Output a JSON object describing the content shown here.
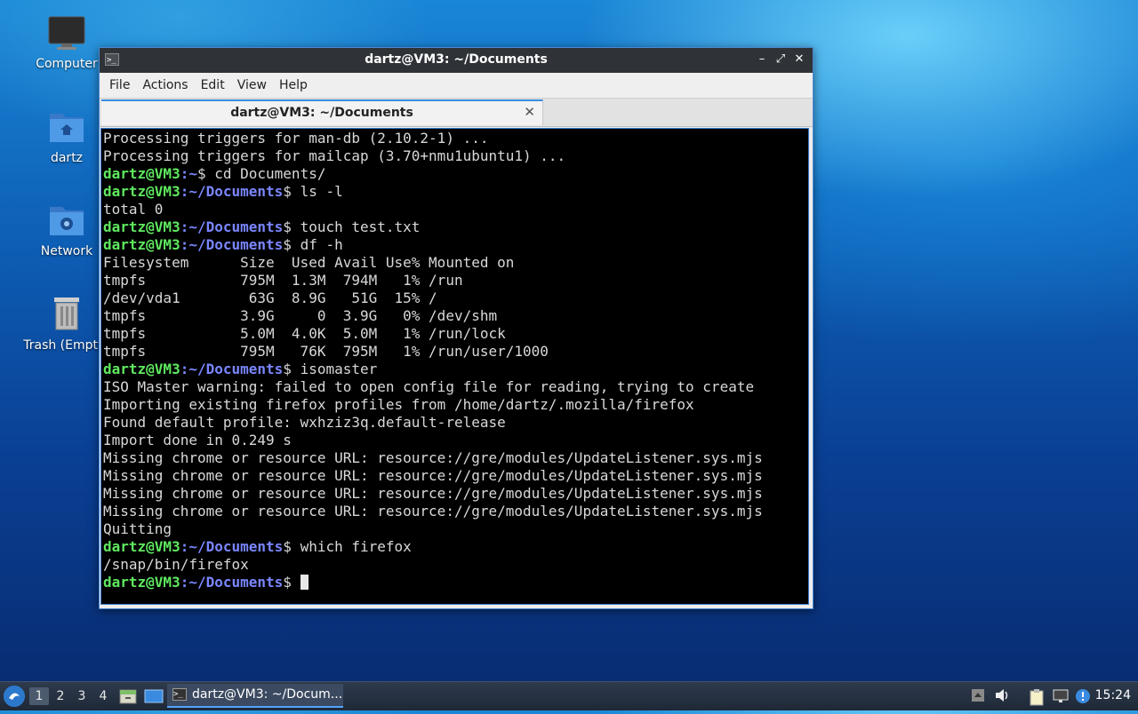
{
  "desktop": {
    "icons": [
      {
        "label": "Computer",
        "icon": "monitor-icon"
      },
      {
        "label": "dartz",
        "icon": "home-folder-icon"
      },
      {
        "label": "Network",
        "icon": "network-folder-icon"
      },
      {
        "label": "Trash (Empty)",
        "icon": "trash-icon"
      }
    ]
  },
  "window": {
    "title": "dartz@VM3: ~/Documents",
    "controls": {
      "minimize": "–",
      "maximize": "⤢",
      "close": "✕"
    },
    "menu": [
      "File",
      "Actions",
      "Edit",
      "View",
      "Help"
    ],
    "tab": {
      "label": "dartz@VM3: ~/Documents",
      "close": "✕"
    }
  },
  "terminal": {
    "prompt_user": "dartz@VM3",
    "lines": [
      {
        "text": "Processing triggers for man-db (2.10.2-1) ..."
      },
      {
        "text": "Processing triggers for mailcap (3.70+nmu1ubuntu1) ..."
      },
      {
        "prompt": true,
        "path": "~",
        "cmd": "cd Documents/"
      },
      {
        "prompt": true,
        "path": "~/Documents",
        "cmd": "ls -l"
      },
      {
        "text": "total 0"
      },
      {
        "prompt": true,
        "path": "~/Documents",
        "cmd": "touch test.txt"
      },
      {
        "prompt": true,
        "path": "~/Documents",
        "cmd": "df -h"
      },
      {
        "text": "Filesystem      Size  Used Avail Use% Mounted on"
      },
      {
        "text": "tmpfs           795M  1.3M  794M   1% /run"
      },
      {
        "text": "/dev/vda1        63G  8.9G   51G  15% /"
      },
      {
        "text": "tmpfs           3.9G     0  3.9G   0% /dev/shm"
      },
      {
        "text": "tmpfs           5.0M  4.0K  5.0M   1% /run/lock"
      },
      {
        "text": "tmpfs           795M   76K  795M   1% /run/user/1000"
      },
      {
        "prompt": true,
        "path": "~/Documents",
        "cmd": "isomaster"
      },
      {
        "text": "ISO Master warning: failed to open config file for reading, trying to create"
      },
      {
        "text": "Importing existing firefox profiles from /home/dartz/.mozilla/firefox"
      },
      {
        "text": "Found default profile: wxhziz3q.default-release"
      },
      {
        "text": "Import done in 0.249 s"
      },
      {
        "text": "Missing chrome or resource URL: resource://gre/modules/UpdateListener.sys.mjs"
      },
      {
        "text": "Missing chrome or resource URL: resource://gre/modules/UpdateListener.sys.mjs"
      },
      {
        "text": "Missing chrome or resource URL: resource://gre/modules/UpdateListener.sys.mjs"
      },
      {
        "text": "Missing chrome or resource URL: resource://gre/modules/UpdateListener.sys.mjs"
      },
      {
        "text": "Quitting"
      },
      {
        "prompt": true,
        "path": "~/Documents",
        "cmd": "which firefox"
      },
      {
        "text": "/snap/bin/firefox"
      },
      {
        "prompt": true,
        "path": "~/Documents",
        "cmd": "",
        "cursor": true
      }
    ]
  },
  "taskbar": {
    "workspaces": [
      "1",
      "2",
      "3",
      "4"
    ],
    "active_workspace": "1",
    "task_label": "dartz@VM3: ~/Docum...",
    "clock": "15:24"
  },
  "colors": {
    "prompt_user": "#5fe85f",
    "prompt_path": "#7a86ff",
    "terminal_bg": "#000000",
    "accent": "#3b8fe0"
  }
}
